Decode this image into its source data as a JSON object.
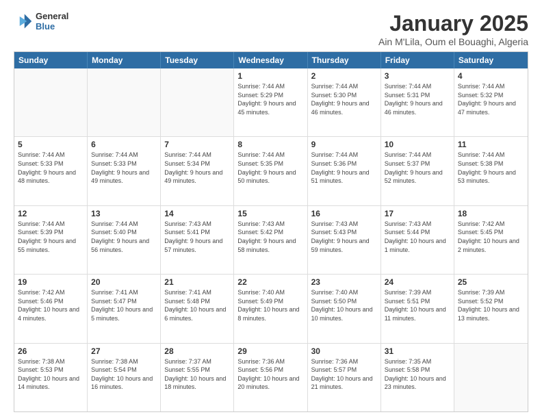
{
  "logo": {
    "line1": "General",
    "line2": "Blue"
  },
  "title": "January 2025",
  "subtitle": "Ain M'Lila, Oum el Bouaghi, Algeria",
  "weekdays": [
    "Sunday",
    "Monday",
    "Tuesday",
    "Wednesday",
    "Thursday",
    "Friday",
    "Saturday"
  ],
  "rows": [
    [
      {
        "day": "",
        "info": ""
      },
      {
        "day": "",
        "info": ""
      },
      {
        "day": "",
        "info": ""
      },
      {
        "day": "1",
        "info": "Sunrise: 7:44 AM\nSunset: 5:29 PM\nDaylight: 9 hours and 45 minutes."
      },
      {
        "day": "2",
        "info": "Sunrise: 7:44 AM\nSunset: 5:30 PM\nDaylight: 9 hours and 46 minutes."
      },
      {
        "day": "3",
        "info": "Sunrise: 7:44 AM\nSunset: 5:31 PM\nDaylight: 9 hours and 46 minutes."
      },
      {
        "day": "4",
        "info": "Sunrise: 7:44 AM\nSunset: 5:32 PM\nDaylight: 9 hours and 47 minutes."
      }
    ],
    [
      {
        "day": "5",
        "info": "Sunrise: 7:44 AM\nSunset: 5:33 PM\nDaylight: 9 hours and 48 minutes."
      },
      {
        "day": "6",
        "info": "Sunrise: 7:44 AM\nSunset: 5:33 PM\nDaylight: 9 hours and 49 minutes."
      },
      {
        "day": "7",
        "info": "Sunrise: 7:44 AM\nSunset: 5:34 PM\nDaylight: 9 hours and 49 minutes."
      },
      {
        "day": "8",
        "info": "Sunrise: 7:44 AM\nSunset: 5:35 PM\nDaylight: 9 hours and 50 minutes."
      },
      {
        "day": "9",
        "info": "Sunrise: 7:44 AM\nSunset: 5:36 PM\nDaylight: 9 hours and 51 minutes."
      },
      {
        "day": "10",
        "info": "Sunrise: 7:44 AM\nSunset: 5:37 PM\nDaylight: 9 hours and 52 minutes."
      },
      {
        "day": "11",
        "info": "Sunrise: 7:44 AM\nSunset: 5:38 PM\nDaylight: 9 hours and 53 minutes."
      }
    ],
    [
      {
        "day": "12",
        "info": "Sunrise: 7:44 AM\nSunset: 5:39 PM\nDaylight: 9 hours and 55 minutes."
      },
      {
        "day": "13",
        "info": "Sunrise: 7:44 AM\nSunset: 5:40 PM\nDaylight: 9 hours and 56 minutes."
      },
      {
        "day": "14",
        "info": "Sunrise: 7:43 AM\nSunset: 5:41 PM\nDaylight: 9 hours and 57 minutes."
      },
      {
        "day": "15",
        "info": "Sunrise: 7:43 AM\nSunset: 5:42 PM\nDaylight: 9 hours and 58 minutes."
      },
      {
        "day": "16",
        "info": "Sunrise: 7:43 AM\nSunset: 5:43 PM\nDaylight: 9 hours and 59 minutes."
      },
      {
        "day": "17",
        "info": "Sunrise: 7:43 AM\nSunset: 5:44 PM\nDaylight: 10 hours and 1 minute."
      },
      {
        "day": "18",
        "info": "Sunrise: 7:42 AM\nSunset: 5:45 PM\nDaylight: 10 hours and 2 minutes."
      }
    ],
    [
      {
        "day": "19",
        "info": "Sunrise: 7:42 AM\nSunset: 5:46 PM\nDaylight: 10 hours and 4 minutes."
      },
      {
        "day": "20",
        "info": "Sunrise: 7:41 AM\nSunset: 5:47 PM\nDaylight: 10 hours and 5 minutes."
      },
      {
        "day": "21",
        "info": "Sunrise: 7:41 AM\nSunset: 5:48 PM\nDaylight: 10 hours and 6 minutes."
      },
      {
        "day": "22",
        "info": "Sunrise: 7:40 AM\nSunset: 5:49 PM\nDaylight: 10 hours and 8 minutes."
      },
      {
        "day": "23",
        "info": "Sunrise: 7:40 AM\nSunset: 5:50 PM\nDaylight: 10 hours and 10 minutes."
      },
      {
        "day": "24",
        "info": "Sunrise: 7:39 AM\nSunset: 5:51 PM\nDaylight: 10 hours and 11 minutes."
      },
      {
        "day": "25",
        "info": "Sunrise: 7:39 AM\nSunset: 5:52 PM\nDaylight: 10 hours and 13 minutes."
      }
    ],
    [
      {
        "day": "26",
        "info": "Sunrise: 7:38 AM\nSunset: 5:53 PM\nDaylight: 10 hours and 14 minutes."
      },
      {
        "day": "27",
        "info": "Sunrise: 7:38 AM\nSunset: 5:54 PM\nDaylight: 10 hours and 16 minutes."
      },
      {
        "day": "28",
        "info": "Sunrise: 7:37 AM\nSunset: 5:55 PM\nDaylight: 10 hours and 18 minutes."
      },
      {
        "day": "29",
        "info": "Sunrise: 7:36 AM\nSunset: 5:56 PM\nDaylight: 10 hours and 20 minutes."
      },
      {
        "day": "30",
        "info": "Sunrise: 7:36 AM\nSunset: 5:57 PM\nDaylight: 10 hours and 21 minutes."
      },
      {
        "day": "31",
        "info": "Sunrise: 7:35 AM\nSunset: 5:58 PM\nDaylight: 10 hours and 23 minutes."
      },
      {
        "day": "",
        "info": ""
      }
    ]
  ]
}
